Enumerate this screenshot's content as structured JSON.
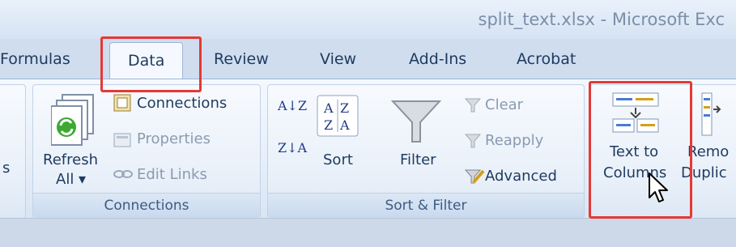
{
  "window": {
    "title": "split_text.xlsx - Microsoft Exc"
  },
  "tabs": {
    "formulas": "Formulas",
    "data": "Data",
    "review": "Review",
    "view": "View",
    "addins": "Add-Ins",
    "acrobat": "Acrobat"
  },
  "groups": {
    "connections": {
      "label": "Connections",
      "refresh_line1": "Refresh",
      "refresh_line2": "All ▾",
      "connections": "Connections",
      "properties": "Properties",
      "edit_links": "Edit Links"
    },
    "sort_filter": {
      "label": "Sort & Filter",
      "sort": "Sort",
      "filter": "Filter",
      "clear": "Clear",
      "reapply": "Reapply",
      "advanced": "Advanced",
      "az": "A↓Z",
      "za": "Z↓A"
    },
    "data_tools": {
      "text_to_line1": "Text to",
      "text_to_line2": "Columns",
      "remove_line1": "Remo",
      "remove_line2": "Duplic"
    }
  },
  "left_edge": {
    "cut_label": "s"
  }
}
